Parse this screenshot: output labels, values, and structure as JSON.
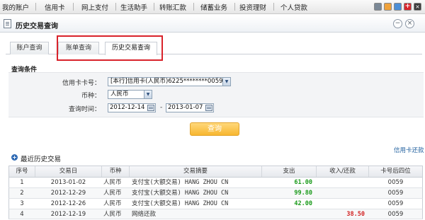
{
  "top_nav": {
    "items": [
      "我的账户",
      "信用卡",
      "网上支付",
      "生活助手",
      "转账汇款",
      "储蓄业务",
      "投资理财",
      "个人贷款"
    ]
  },
  "title_bar": {
    "title": "历史交易查询",
    "minimize_icon": "minus-icon",
    "close_icon": "close-icon"
  },
  "tabs": [
    {
      "label": "账户查询",
      "active": false
    },
    {
      "label": "账单查询",
      "active": false
    },
    {
      "label": "历史交易查询",
      "active": true
    }
  ],
  "query_conditions": {
    "title": "查询条件",
    "card_label": "信用卡卡号：",
    "card_value": "[本行]信用卡(人民币)6225********0059",
    "currency_label": "币种：",
    "currency_value": "人民币",
    "time_label": "查询时间：",
    "date_from": "2012-12-14",
    "date_separator": "-",
    "date_to": "2013-01-07",
    "query_button": "查询"
  },
  "links": {
    "credit_card_repay": "信用卡还款"
  },
  "recent": {
    "title": "最近历史交易"
  },
  "table": {
    "headers": [
      "序号",
      "交易日",
      "币种",
      "交易摘要",
      "支出",
      "收入/还款",
      "卡号后四位"
    ],
    "rows": [
      {
        "no": "1",
        "date": "2013-01-02",
        "currency": "人民币",
        "summary": "支付宝(大额交易) HANG ZHOU CN",
        "expense": "61.00",
        "income": "",
        "card": "0059"
      },
      {
        "no": "2",
        "date": "2012-12-29",
        "currency": "人民币",
        "summary": "支付宝(大额交易) HANG ZHOU CN",
        "expense": "99.80",
        "income": "",
        "card": "0059"
      },
      {
        "no": "3",
        "date": "2012-12-26",
        "currency": "人民币",
        "summary": "支付宝(大额交易) HANG ZHOU CN",
        "expense": "42.00",
        "income": "",
        "card": "0059"
      },
      {
        "no": "4",
        "date": "2012-12-19",
        "currency": "人民币",
        "summary": "网络还款",
        "expense": "",
        "income": "38.50",
        "card": "0059"
      }
    ]
  },
  "colors": {
    "highlight_box": "#d9232b",
    "query_button": "#f7b630",
    "expense": "#1a9a1a",
    "income": "#d22424",
    "link": "#1f5f9e"
  }
}
